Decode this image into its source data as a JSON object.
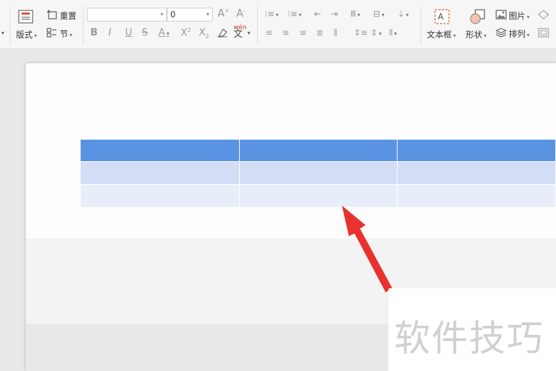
{
  "toolbar": {
    "layout_label": "版式",
    "reset_label": "重置",
    "section_label": "节",
    "font_name_value": "",
    "font_size_value": "0",
    "textbox_label": "文本框",
    "shape_label": "形状",
    "picture_label": "图片",
    "arrange_label": "排列"
  },
  "table": {
    "columns": 3,
    "header_color": "#5b93e3",
    "row1_color": "#d2def5",
    "row2_color": "#e8eef9",
    "rows": [
      [
        "",
        "",
        ""
      ],
      [
        "",
        "",
        ""
      ],
      [
        "",
        "",
        ""
      ]
    ]
  },
  "annotation": {
    "arrow_color": "#e8322f",
    "points_to": "table"
  },
  "watermark": {
    "text": "软件技巧"
  }
}
